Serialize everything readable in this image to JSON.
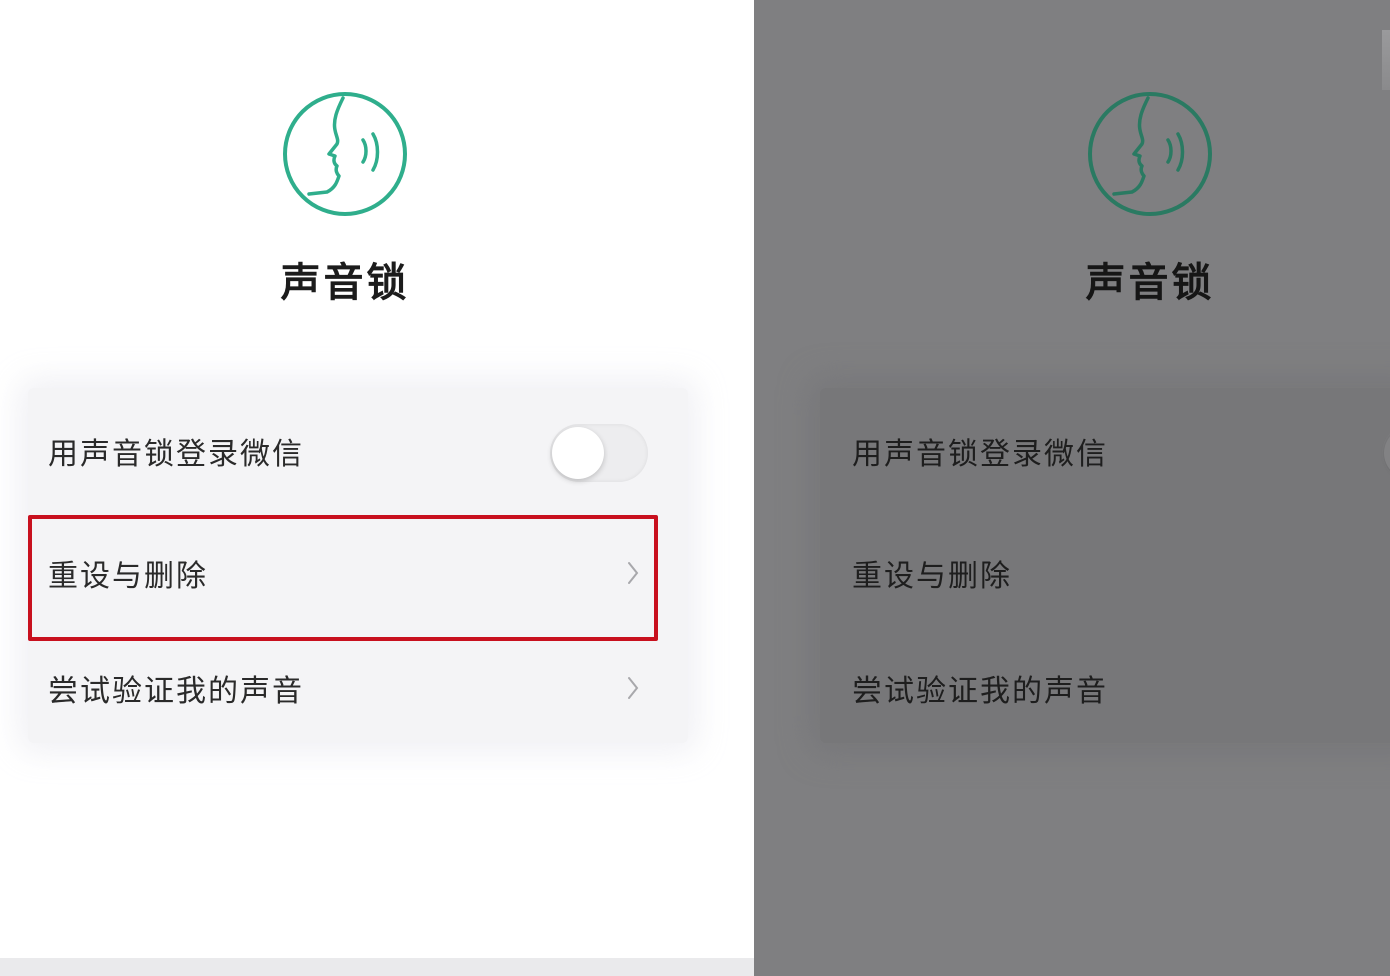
{
  "colors": {
    "accent_teal": "#2fae8c",
    "highlight_red": "#c8101e",
    "overlay_gray": "#7f7f81"
  },
  "left_panel": {
    "title": "声音锁",
    "logo_icon": "voice-lock-face-icon",
    "items": [
      {
        "label": "用声音锁登录微信",
        "control": "toggle",
        "toggle_on": false
      },
      {
        "label": "重设与删除",
        "control": "chevron-right-icon"
      },
      {
        "label": "尝试验证我的声音",
        "control": "chevron-right-icon"
      }
    ]
  },
  "right_panel": {
    "title": "声音锁",
    "logo_icon": "voice-lock-face-icon",
    "items": [
      {
        "label": "用声音锁登录微信",
        "control": "toggle",
        "toggle_on": false
      },
      {
        "label": "重设与删除"
      },
      {
        "label": "尝试验证我的声音"
      }
    ]
  }
}
